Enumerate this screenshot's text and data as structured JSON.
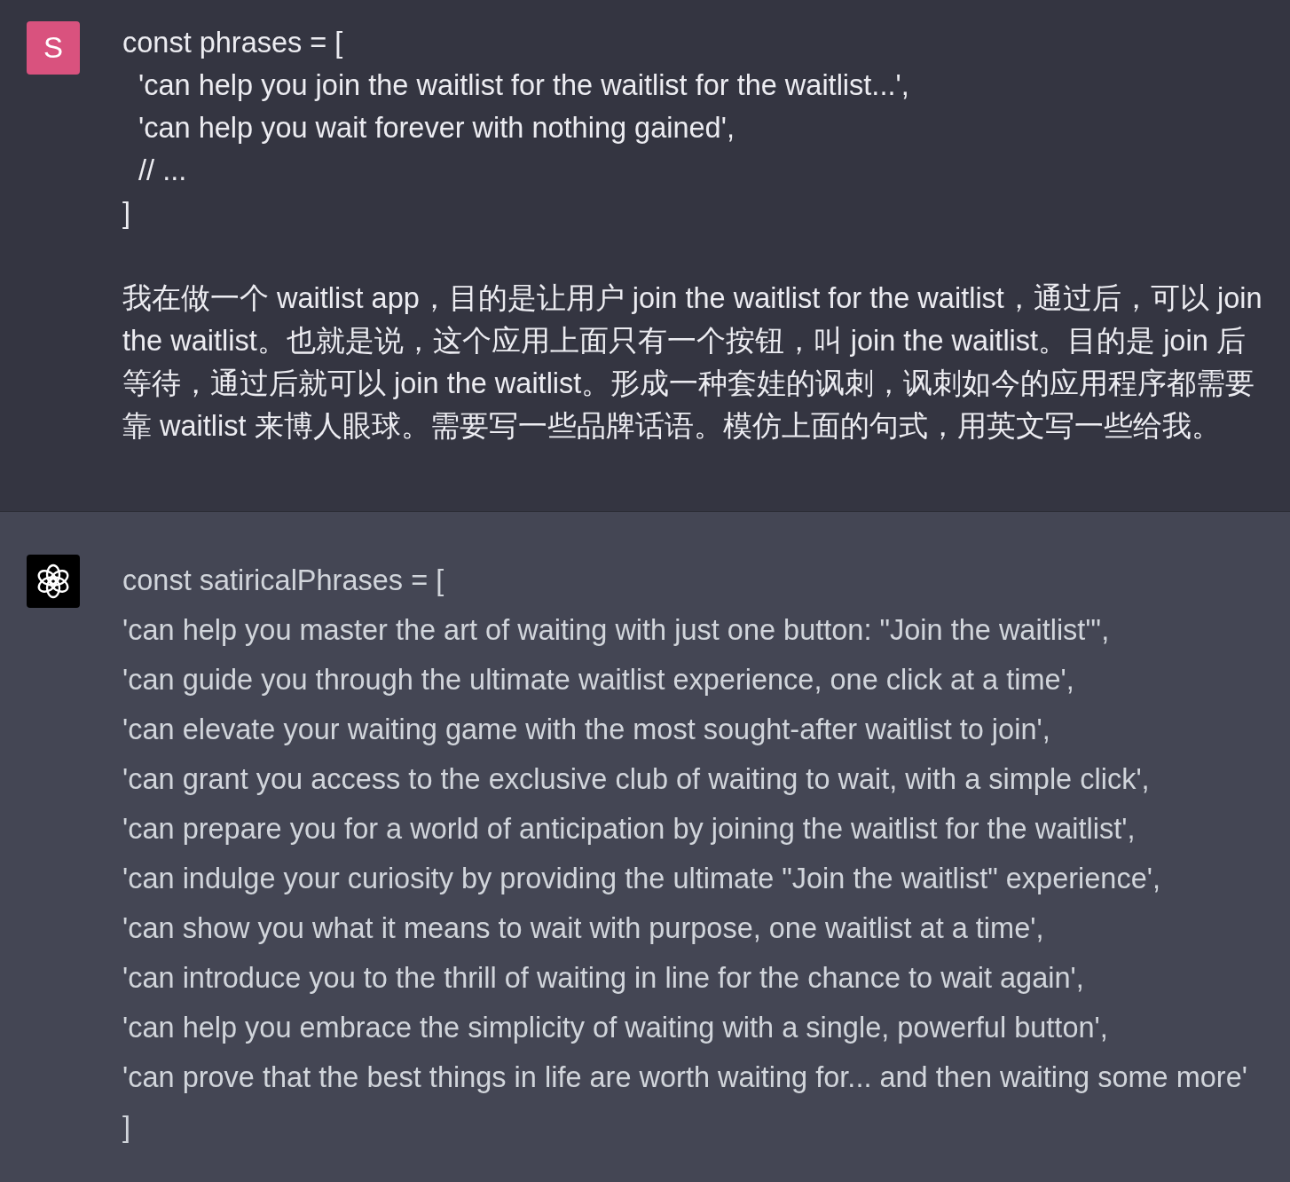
{
  "conversation": [
    {
      "kind": "user",
      "avatar": "S",
      "code_lines": [
        "const phrases = [",
        "  'can help you join the waitlist for the waitlist for the waitlist...',",
        "  'can help you wait forever with nothing gained',",
        "  // ...",
        "]"
      ],
      "text": "我在做一个 waitlist app，目的是让用户 join the waitlist for the waitlist，通过后，可以 join the waitlist。也就是说，这个应用上面只有一个按钮，叫 join the waitlist。目的是 join 后等待，通过后就可以 join the waitlist。形成一种套娃的讽刺，讽刺如今的应用程序都需要靠 waitlist 来博人眼球。需要写一些品牌话语。模仿上面的句式，用英文写一些给我。"
    },
    {
      "kind": "assistant",
      "code_lines": [
        "const satiricalPhrases = [",
        "'can help you master the art of waiting with just one button: \"Join the waitlist\"',",
        "'can guide you through the ultimate waitlist experience, one click at a time',",
        "'can elevate your waiting game with the most sought-after waitlist to join',",
        "'can grant you access to the exclusive club of waiting to wait, with a simple click',",
        "'can prepare you for a world of anticipation by joining the waitlist for the waitlist',",
        "'can indulge your curiosity by providing the ultimate \"Join the waitlist\" experience',",
        "'can show you what it means to wait with purpose, one waitlist at a time',",
        "'can introduce you to the thrill of waiting in line for the chance to wait again',",
        "'can help you embrace the simplicity of waiting with a single, powerful button',",
        "'can prove that the best things in life are worth waiting for... and then waiting some more'",
        "]"
      ]
    }
  ]
}
